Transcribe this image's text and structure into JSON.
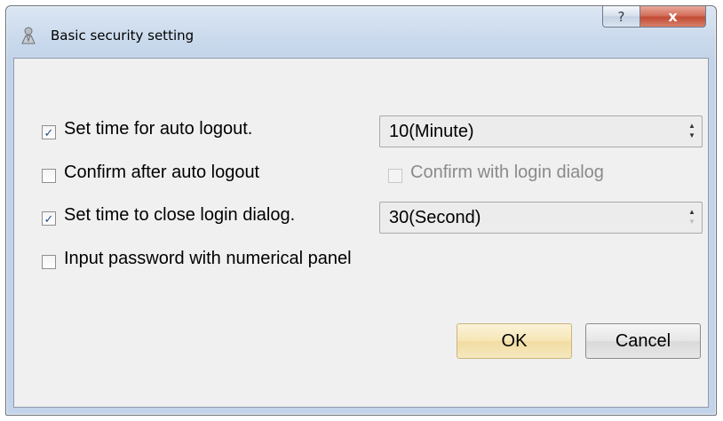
{
  "window": {
    "title": "Basic security setting",
    "help_button": "?",
    "close_button": "x"
  },
  "auto_logout": {
    "checked": true,
    "label": "Set time for auto logout.",
    "value": "10(Minute)"
  },
  "confirm_logout": {
    "checked": false,
    "label": "Confirm after auto logout"
  },
  "confirm_login_dialog": {
    "checked": false,
    "enabled": false,
    "label": "Confirm with login dialog"
  },
  "close_login_dialog": {
    "checked": true,
    "label": "Set time to close login dialog.",
    "value": "30(Second)"
  },
  "numerical_panel": {
    "checked": false,
    "label": "Input password with numerical panel"
  },
  "buttons": {
    "ok": "OK",
    "cancel": "Cancel"
  },
  "icons": {
    "check": "check-icon",
    "app": "user-key-icon",
    "spin_up": "spin-up-icon",
    "spin_down": "spin-down-icon"
  }
}
